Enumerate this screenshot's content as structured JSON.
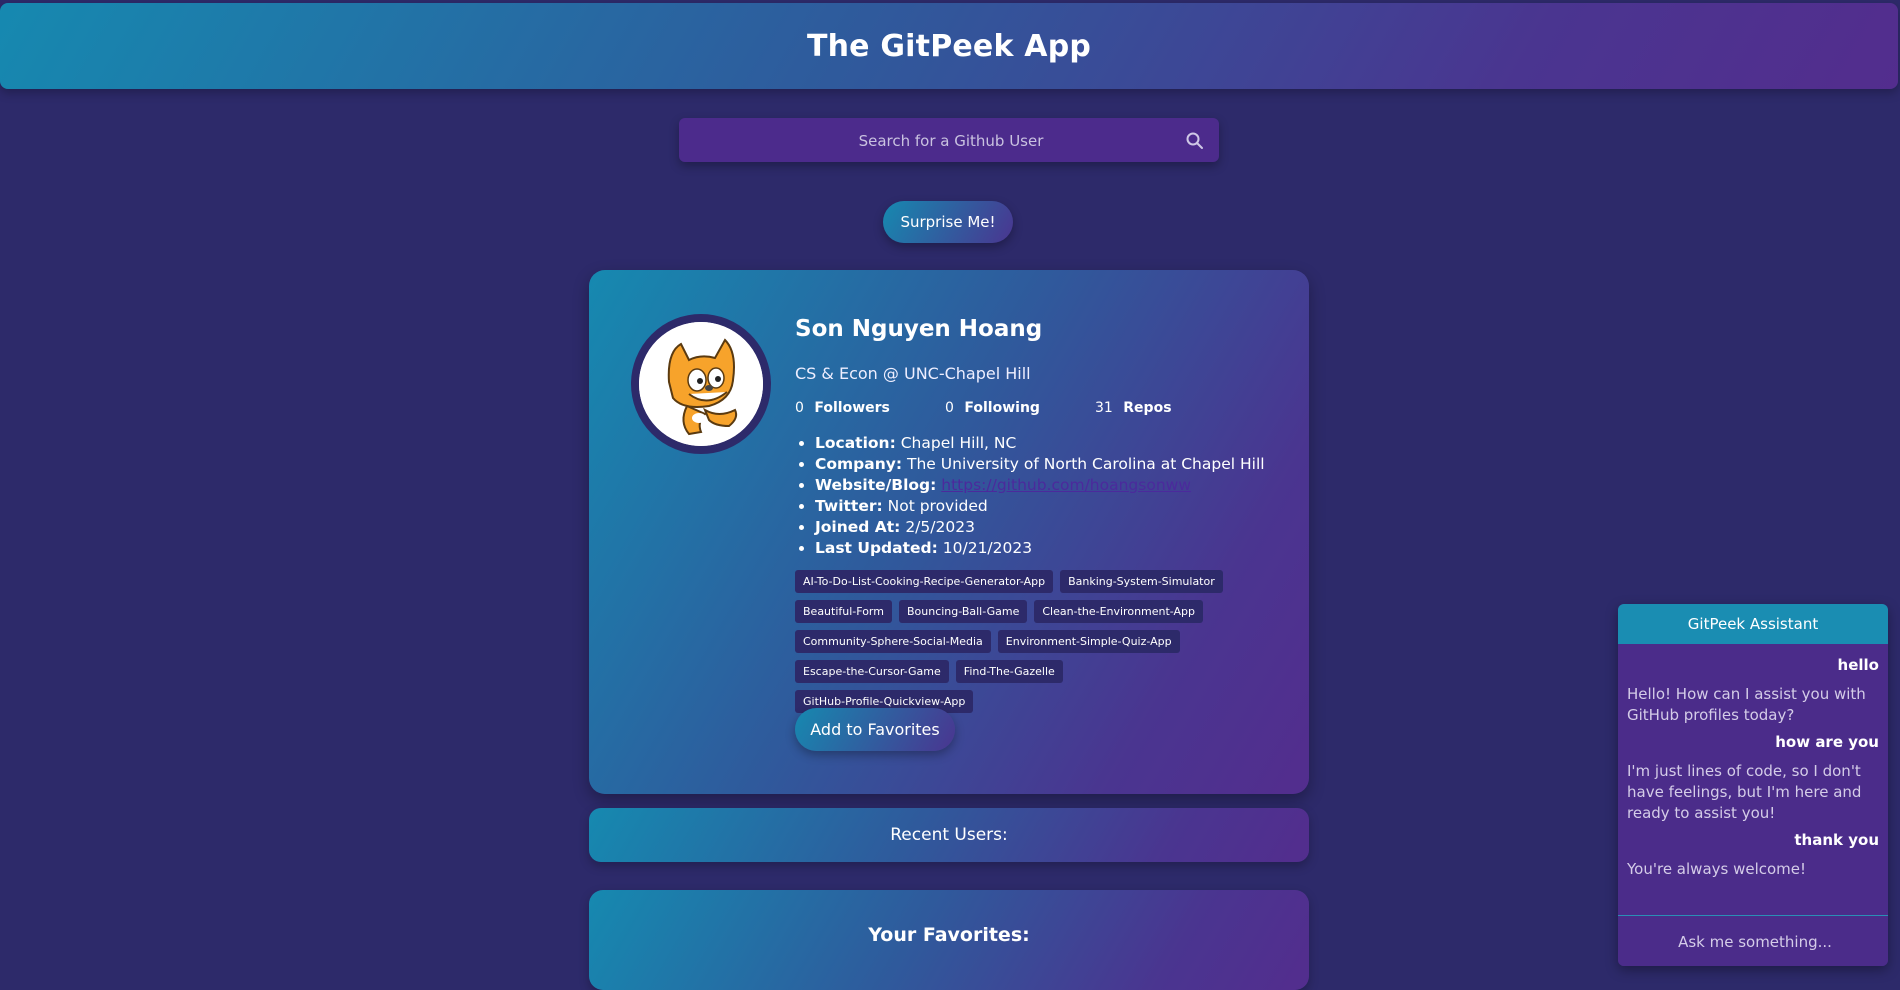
{
  "header": {
    "title": "The GitPeek App"
  },
  "search": {
    "placeholder": "Search for a Github User"
  },
  "surprise_label": "Surprise Me!",
  "profile": {
    "name": "Son Nguyen Hoang",
    "bio": "CS & Econ @ UNC-Chapel Hill",
    "stats": [
      {
        "value": "0",
        "label": "Followers"
      },
      {
        "value": "0",
        "label": "Following"
      },
      {
        "value": "31",
        "label": "Repos"
      }
    ],
    "details": {
      "location_label": "Location:",
      "location": "Chapel Hill, NC",
      "company_label": "Company:",
      "company": "The University of North Carolina at Chapel Hill",
      "website_label": "Website/Blog:",
      "website": "https://github.com/hoangsonww",
      "twitter_label": "Twitter:",
      "twitter": "Not provided",
      "joined_label": "Joined At:",
      "joined": "2/5/2023",
      "updated_label": "Last Updated:",
      "updated": "10/21/2023"
    },
    "repos": [
      "AI-To-Do-List-Cooking-Recipe-Generator-App",
      "Banking-System-Simulator",
      "Beautiful-Form",
      "Bouncing-Ball-Game",
      "Clean-the-Environment-App",
      "Community-Sphere-Social-Media",
      "Environment-Simple-Quiz-App",
      "Escape-the-Cursor-Game",
      "Find-The-Gazelle",
      "GitHub-Profile-Quickview-App"
    ],
    "add_favorites_label": "Add to Favorites"
  },
  "recent_users_label": "Recent Users:",
  "favorites_title": "Your Favorites:",
  "chat": {
    "title": "GitPeek Assistant",
    "messages": [
      {
        "role": "user",
        "text": "hello"
      },
      {
        "role": "bot",
        "text": "Hello! How can I assist you with GitHub profiles today?"
      },
      {
        "role": "user",
        "text": "how are you"
      },
      {
        "role": "bot",
        "text": "I'm just lines of code, so I don't have feelings, but I'm here and ready to assist you!"
      },
      {
        "role": "user",
        "text": "thank you"
      },
      {
        "role": "bot",
        "text": "You're always welcome!"
      }
    ],
    "input_placeholder": "Ask me something..."
  }
}
